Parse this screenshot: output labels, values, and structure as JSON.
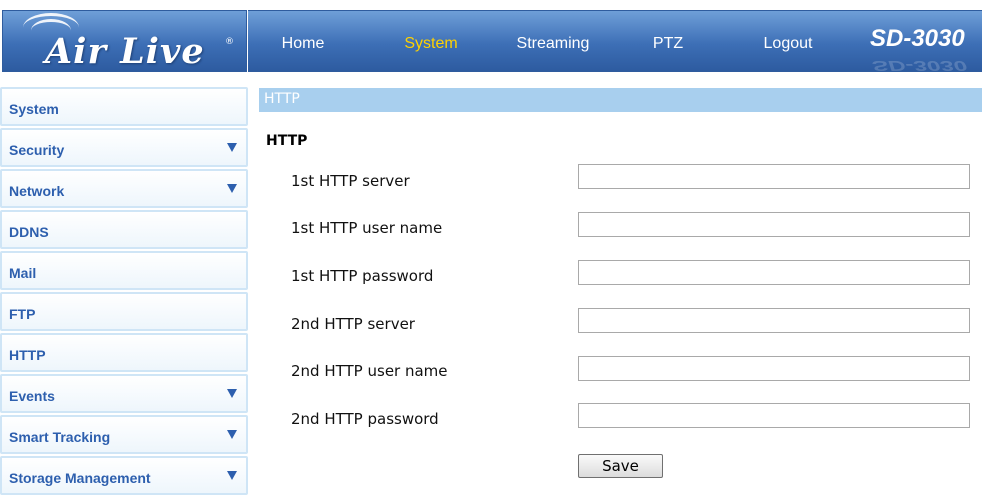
{
  "brand": {
    "logo_text": "Air Live",
    "logo_mark": "®",
    "model": "SD-3030"
  },
  "nav": {
    "items": [
      {
        "label": "Home",
        "active": false
      },
      {
        "label": "System",
        "active": true
      },
      {
        "label": "Streaming",
        "active": false
      },
      {
        "label": "PTZ",
        "active": false
      },
      {
        "label": "Logout",
        "active": false
      }
    ]
  },
  "sidebar": {
    "items": [
      {
        "label": "System",
        "expandable": false
      },
      {
        "label": "Security",
        "expandable": true
      },
      {
        "label": "Network",
        "expandable": true
      },
      {
        "label": "DDNS",
        "expandable": false
      },
      {
        "label": "Mail",
        "expandable": false
      },
      {
        "label": "FTP",
        "expandable": false
      },
      {
        "label": "HTTP",
        "expandable": false
      },
      {
        "label": "Events",
        "expandable": true
      },
      {
        "label": "Smart Tracking",
        "expandable": true
      },
      {
        "label": "Storage Management",
        "expandable": true
      }
    ],
    "expand_icon": "triangle-down-icon"
  },
  "main": {
    "section_title": "HTTP",
    "subheading": "HTTP",
    "fields": [
      {
        "label": "1st HTTP server",
        "value": "",
        "type": "text"
      },
      {
        "label": "1st HTTP user name",
        "value": "",
        "type": "text"
      },
      {
        "label": "1st HTTP password",
        "value": "",
        "type": "password"
      },
      {
        "label": "2nd HTTP server",
        "value": "",
        "type": "text"
      },
      {
        "label": "2nd HTTP user name",
        "value": "",
        "type": "text"
      },
      {
        "label": "2nd HTTP password",
        "value": "",
        "type": "password"
      }
    ],
    "save_label": "Save"
  },
  "colors": {
    "header_blue": "#3d6fb6",
    "active_nav": "#ffd200",
    "sidebar_text": "#2d5fae",
    "section_bar": "#a8cfee"
  }
}
